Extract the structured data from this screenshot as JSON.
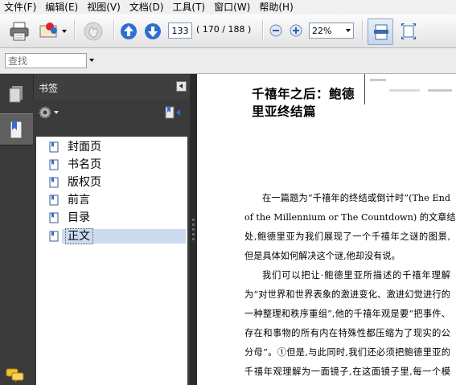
{
  "menu": [
    "文件(F)",
    "编辑(E)",
    "视图(V)",
    "文档(D)",
    "工具(T)",
    "窗口(W)",
    "帮助(H)"
  ],
  "toolbar": {
    "page_current": "133",
    "page_total": "( 170 / 188 )",
    "zoom": "22%"
  },
  "find": {
    "placeholder": "查找"
  },
  "panel": {
    "title": "书签",
    "bookmarks": [
      {
        "label": "封面页"
      },
      {
        "label": "书名页"
      },
      {
        "label": "版权页"
      },
      {
        "label": "前言"
      },
      {
        "label": "目录"
      },
      {
        "label": "正文",
        "selected": true
      }
    ]
  },
  "document": {
    "title_lines": [
      "千禧年之后：鲍德",
      "里亚终结篇"
    ],
    "lines": [
      "在一篇题为“千禧年的终结或倒计时”(The End",
      "of the Millennium or The Countdown) 的文章结尾",
      "处,鲍德里亚为我们展现了一个千禧年之谜的图景,",
      "但是具体如何解决这个谜,他却没有说。",
      "我们可以把让·鲍德里亚所描述的千禧年理解",
      "为“对世界和世界表象的激进变化、激进幻觉进行的",
      "一种整理和秩序重组”,他的千禧年观是要“把事件、",
      "存在和事物的所有内在特殊性都压缩为了现实的公",
      "分母”。①但是,与此同时,我们还必须把鲍德里亚的",
      "千禧年观理解为一面镜子,在这面镜子里,每一个模"
    ]
  },
  "colors": {
    "panel_dark": "#3a3a3a",
    "selection": "#cddbef",
    "arrow_blue": "#2f6fcf"
  }
}
